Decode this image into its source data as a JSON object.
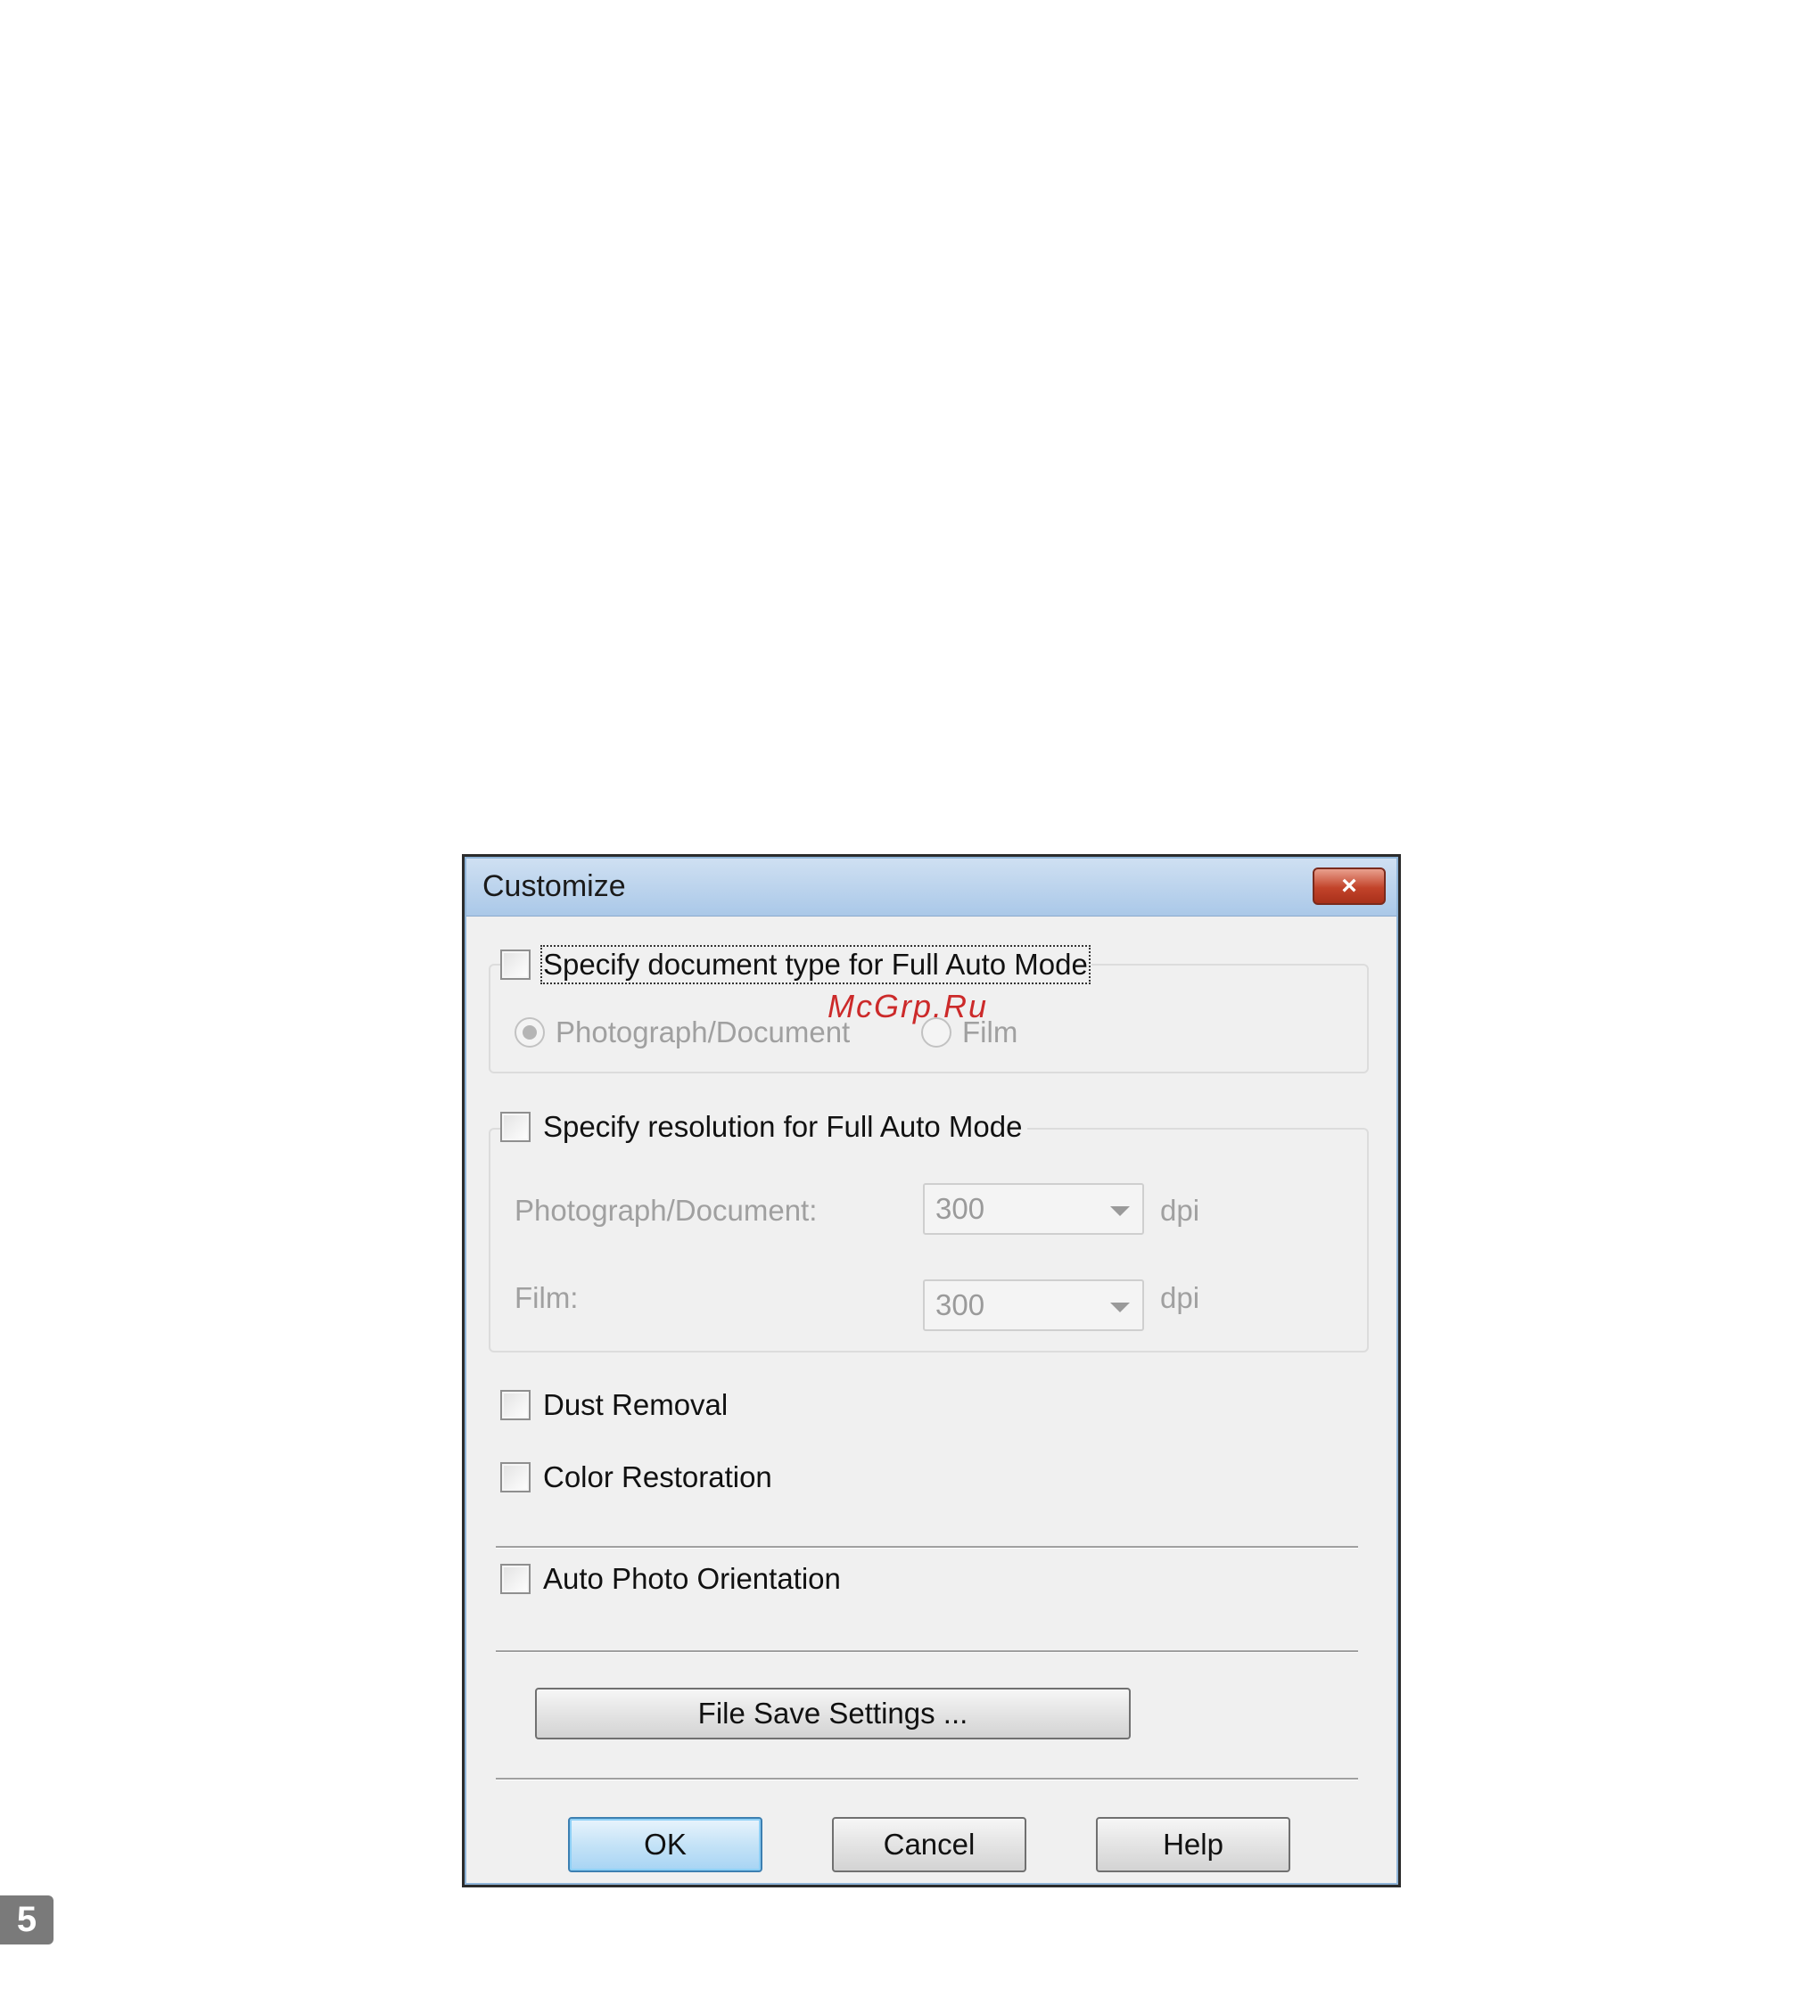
{
  "dialog": {
    "title": "Customize",
    "close_label": "×"
  },
  "doc_type_group": {
    "checkbox_label": "Specify document type for Full Auto Mode",
    "checked": false,
    "radio_photo_label": "Photograph/Document",
    "radio_photo_selected": true,
    "radio_film_label": "Film",
    "radio_film_selected": false
  },
  "resolution_group": {
    "checkbox_label": "Specify resolution for Full Auto Mode",
    "checked": false,
    "photo_label": "Photograph/Document:",
    "photo_value": "300",
    "photo_unit": "dpi",
    "film_label": "Film:",
    "film_value": "300",
    "film_unit": "dpi"
  },
  "options": {
    "dust_removal": "Dust Removal",
    "color_restoration": "Color Restoration",
    "auto_photo_orientation": "Auto Photo Orientation"
  },
  "buttons": {
    "file_save_settings": "File Save Settings ...",
    "ok": "OK",
    "cancel": "Cancel",
    "help": "Help"
  },
  "watermark": "McGrp.Ru",
  "page_number": "5"
}
